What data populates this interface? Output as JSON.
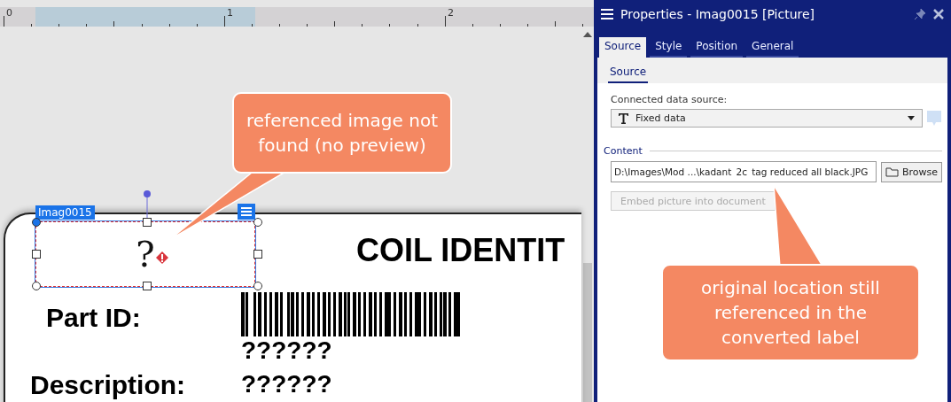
{
  "ruler": {
    "ticks": [
      "0",
      "1",
      "2"
    ]
  },
  "label": {
    "object_name": "Imag0015",
    "placeholder_glyph": "?",
    "title": "COIL IDENTIT",
    "fields": [
      {
        "label": "Part ID:",
        "value": "??????"
      },
      {
        "label": "Description:",
        "value": "??????"
      }
    ]
  },
  "callouts": [
    {
      "text": "referenced image not found (no preview)"
    },
    {
      "text": "original location still referenced in the converted label"
    }
  ],
  "panel": {
    "title": "Properties - Imag0015 [Picture]",
    "tabs": [
      {
        "label": "Source",
        "selected": true
      },
      {
        "label": "Style",
        "selected": false
      },
      {
        "label": "Position",
        "selected": false
      },
      {
        "label": "General",
        "selected": false
      }
    ],
    "subtabs": [
      {
        "label": "Source",
        "selected": true
      }
    ],
    "data_source_label": "Connected data source:",
    "data_source": "Fixed data",
    "content_label": "Content",
    "path": "D:\\Images\\Mod ...\\kadant_2c_tag reduced all black.JPG",
    "browse": "Browse",
    "embed": {
      "label": "Embed picture into document",
      "disabled": true
    }
  }
}
